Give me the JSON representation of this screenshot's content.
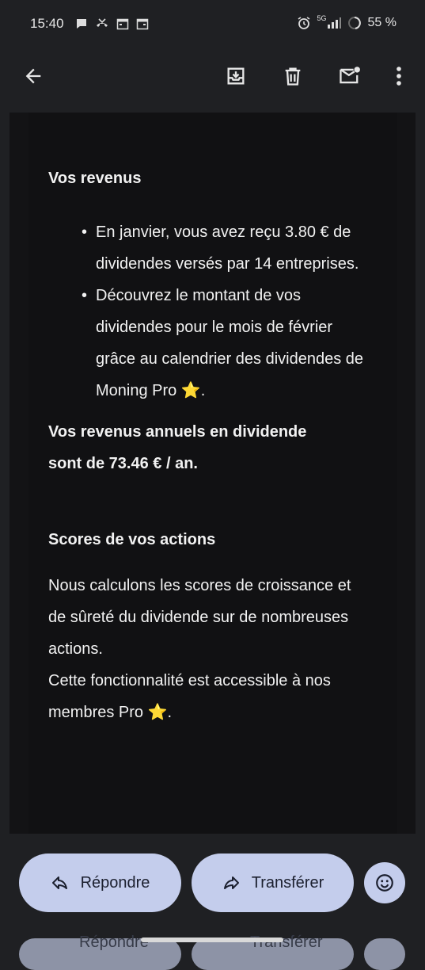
{
  "status_bar": {
    "time": "15:40",
    "network": "5G",
    "battery": "55 %"
  },
  "toolbar": {
    "icons": [
      "back-arrow-icon",
      "archive-icon",
      "delete-icon",
      "mark-unread-icon",
      "more-vert-icon"
    ]
  },
  "email": {
    "revenus_title": "Vos revenus",
    "bullets": [
      {
        "text": "En janvier, vous avez reçu 3.80 € de dividendes versés par 14 entreprises."
      },
      {
        "text": "Découvrez le montant de vos dividendes pour le mois de février grâce au calendrier des dividendes de Moning Pro",
        "emoji": "⭐",
        "end": "."
      }
    ],
    "annual_line1": "Vos revenus annuels en dividende",
    "annual_line2": "sont de 73.46 € / an.",
    "scores_title": "Scores de vos actions",
    "scores_p1": "Nous calculons les scores de croissance et de sûreté du dividende sur de nombreuses actions.",
    "scores_p2": "Cette fonctionnalité est accessible à nos membres Pro",
    "scores_p2_emoji": "⭐",
    "scores_p2_end": "."
  },
  "actions": {
    "reply_label": "Répondre",
    "forward_label": "Transférer",
    "emoji_icon": "smiley-icon"
  },
  "ghost_actions": {
    "reply_label": "Répondre",
    "forward_label": "Transférer"
  },
  "colors": {
    "background": "#1f2023",
    "email_bg": "#111113",
    "button_bg": "#c4cdec",
    "star": "#f5c518"
  }
}
